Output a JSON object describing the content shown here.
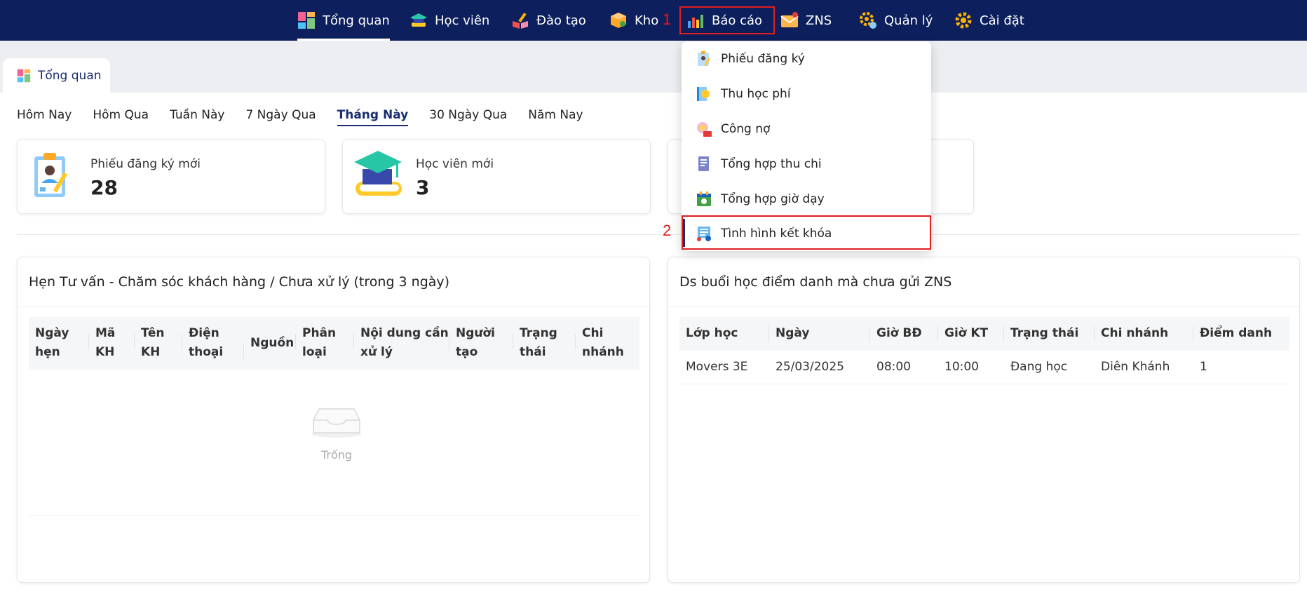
{
  "nav": {
    "items": [
      {
        "label": "Tổng quan",
        "icon": "dashboard-icon"
      },
      {
        "label": "Học viên",
        "icon": "graduation-cap-icon"
      },
      {
        "label": "Đào tạo",
        "icon": "book-pencil-icon"
      },
      {
        "label": "Kho",
        "icon": "box-icon"
      },
      {
        "label": "Báo cáo",
        "icon": "bar-chart-icon"
      },
      {
        "label": "ZNS",
        "icon": "mail-icon"
      },
      {
        "label": "Quản lý",
        "icon": "manage-gear-icon"
      },
      {
        "label": "Cài đặt",
        "icon": "settings-gear-icon"
      }
    ],
    "active": "Tổng quan"
  },
  "markers": {
    "step1": "1",
    "step2": "2"
  },
  "page_tab": {
    "label": "Tổng quan"
  },
  "periods": {
    "items": [
      "Hôm Nay",
      "Hôm Qua",
      "Tuần Này",
      "7 Ngày Qua",
      "Tháng Này",
      "30 Ngày Qua",
      "Năm Nay"
    ],
    "selected": "Tháng Này"
  },
  "stats": [
    {
      "label": "Phiếu đăng ký mới",
      "value": "28",
      "icon": "clipboard-icon"
    },
    {
      "label": "Học viên mới",
      "value": "3",
      "icon": "graduation-cap-icon"
    }
  ],
  "dropdown": {
    "items": [
      {
        "label": "Phiếu đăng ký",
        "icon": "form-icon"
      },
      {
        "label": "Thu học phí",
        "icon": "tuition-icon"
      },
      {
        "label": "Công nợ",
        "icon": "debt-icon"
      },
      {
        "label": "Tổng hợp thu chi",
        "icon": "document-icon"
      },
      {
        "label": "Tổng hợp giờ dạy",
        "icon": "calendar-icon"
      },
      {
        "label": "Tình hình kết khóa",
        "icon": "report-list-icon"
      }
    ]
  },
  "left_panel": {
    "title": "Hẹn Tư vấn - Chăm sóc khách hàng / Chưa xử lý (trong 3 ngày)",
    "columns": [
      [
        "Ngày",
        "hẹn"
      ],
      [
        "Mã",
        "KH"
      ],
      [
        "Tên",
        "KH"
      ],
      [
        "Điện",
        "thoại"
      ],
      [
        "Nguồn"
      ],
      [
        "Phân",
        "loại"
      ],
      [
        "Nội dung cần",
        "xử lý"
      ],
      [
        "Người",
        "tạo"
      ],
      [
        "Trạng",
        "thái"
      ],
      [
        "Chi",
        "nhánh"
      ]
    ],
    "empty_text": "Trống"
  },
  "right_panel": {
    "title": "Ds buổi học điểm danh mà chưa gửi ZNS",
    "columns": [
      "Lớp học",
      "Ngày",
      "Giờ BĐ",
      "Giờ KT",
      "Trạng thái",
      "Chi nhánh",
      "Điểm danh"
    ],
    "rows": [
      [
        "Movers 3E",
        "25/03/2025",
        "08:00",
        "10:00",
        "Đang học",
        "Diên Khánh",
        "1"
      ]
    ]
  },
  "colors": {
    "nav_bg": "#0d1f5c",
    "accent": "#1a2d6e",
    "highlight": "#e01e1e"
  }
}
